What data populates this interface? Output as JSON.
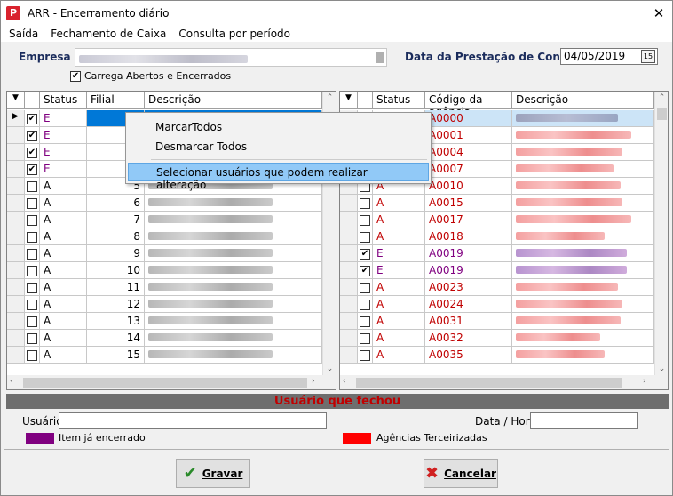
{
  "window": {
    "title": "ARR - Encerramento diário",
    "app_icon": "P",
    "close": "✕"
  },
  "menu": [
    {
      "label": "Saída"
    },
    {
      "label": "Fechamento de Caixa"
    },
    {
      "label": "Consulta por período"
    }
  ],
  "empresa_label": "Empresa",
  "data_prestacao_label": "Data da Prestação de Contas",
  "data_prestacao_value": "04/05/2019",
  "carrega_checkbox": {
    "label": "Carrega Abertos e Encerrados",
    "checked": true
  },
  "left_grid": {
    "headers": {
      "status": "Status",
      "filial": "Filial",
      "descricao": "Descrição"
    },
    "rows": [
      {
        "checked": true,
        "status": "E",
        "filial": ""
      },
      {
        "checked": true,
        "status": "E",
        "filial": ""
      },
      {
        "checked": true,
        "status": "E",
        "filial": ""
      },
      {
        "checked": true,
        "status": "E",
        "filial": ""
      },
      {
        "checked": false,
        "status": "A",
        "filial": "5"
      },
      {
        "checked": false,
        "status": "A",
        "filial": "6"
      },
      {
        "checked": false,
        "status": "A",
        "filial": "7"
      },
      {
        "checked": false,
        "status": "A",
        "filial": "8"
      },
      {
        "checked": false,
        "status": "A",
        "filial": "9"
      },
      {
        "checked": false,
        "status": "A",
        "filial": "10"
      },
      {
        "checked": false,
        "status": "A",
        "filial": "11"
      },
      {
        "checked": false,
        "status": "A",
        "filial": "12"
      },
      {
        "checked": false,
        "status": "A",
        "filial": "13"
      },
      {
        "checked": false,
        "status": "A",
        "filial": "14"
      },
      {
        "checked": false,
        "status": "A",
        "filial": "15"
      }
    ]
  },
  "right_grid": {
    "headers": {
      "status": "Status",
      "codigo": "Código da agência",
      "descricao": "Descrição"
    },
    "rows": [
      {
        "checked": false,
        "status": "A",
        "codigo": "A0000"
      },
      {
        "checked": false,
        "status": "A",
        "codigo": "A0001"
      },
      {
        "checked": false,
        "status": "A",
        "codigo": "A0004"
      },
      {
        "checked": false,
        "status": "A",
        "codigo": "A0007"
      },
      {
        "checked": false,
        "status": "A",
        "codigo": "A0010"
      },
      {
        "checked": false,
        "status": "A",
        "codigo": "A0015"
      },
      {
        "checked": false,
        "status": "A",
        "codigo": "A0017"
      },
      {
        "checked": false,
        "status": "A",
        "codigo": "A0018"
      },
      {
        "checked": true,
        "status": "E",
        "codigo": "A0019"
      },
      {
        "checked": true,
        "status": "E",
        "codigo": "A0019"
      },
      {
        "checked": false,
        "status": "A",
        "codigo": "A0023"
      },
      {
        "checked": false,
        "status": "A",
        "codigo": "A0024"
      },
      {
        "checked": false,
        "status": "A",
        "codigo": "A0031"
      },
      {
        "checked": false,
        "status": "A",
        "codigo": "A0032"
      },
      {
        "checked": false,
        "status": "A",
        "codigo": "A0035"
      }
    ]
  },
  "context_menu": {
    "items": [
      "MarcarTodos",
      "Desmarcar Todos",
      "Selecionar usuários que podem realizar alteração"
    ]
  },
  "usuario_section": {
    "title": "Usuário que fechou",
    "usuario_label": "Usuário",
    "datahora_label": "Data / Hora"
  },
  "legend": {
    "item_encerrado": {
      "label": "Item já encerrado",
      "color": "#7f0f7f"
    },
    "agencias_terceirizadas": {
      "label": "Agências Terceirizadas",
      "color": "#ff0000"
    }
  },
  "buttons": {
    "gravar": "Gravar",
    "cancelar": "Cancelar"
  },
  "colors": {
    "status_e": "#800080",
    "status_a_right": "#c00000",
    "selection": "#3399ff"
  }
}
